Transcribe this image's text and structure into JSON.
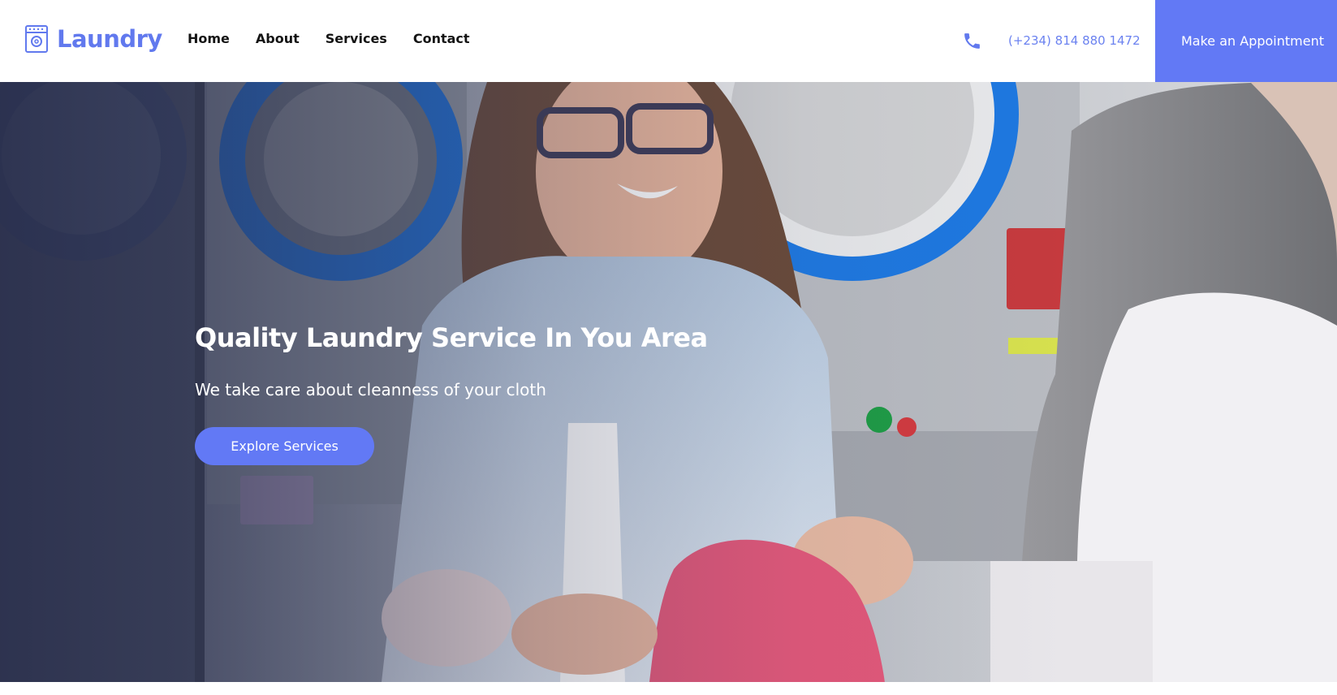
{
  "brand": {
    "name": "Laundry",
    "logo_icon": "washing-machine-icon",
    "accent_color": "#6279f5"
  },
  "nav": {
    "items": [
      {
        "label": "Home"
      },
      {
        "label": "About"
      },
      {
        "label": "Services"
      },
      {
        "label": "Contact"
      }
    ]
  },
  "contact": {
    "phone_icon": "phone-icon",
    "phone": "(+234) 814 880 1472"
  },
  "header": {
    "appointment_label": "Make an Appointment"
  },
  "hero": {
    "title": "Quality Laundry Service In You Area",
    "subtitle": "We take care about cleanness of your cloth",
    "cta_label": "Explore Services",
    "image": "hero-photo-laundromat"
  }
}
